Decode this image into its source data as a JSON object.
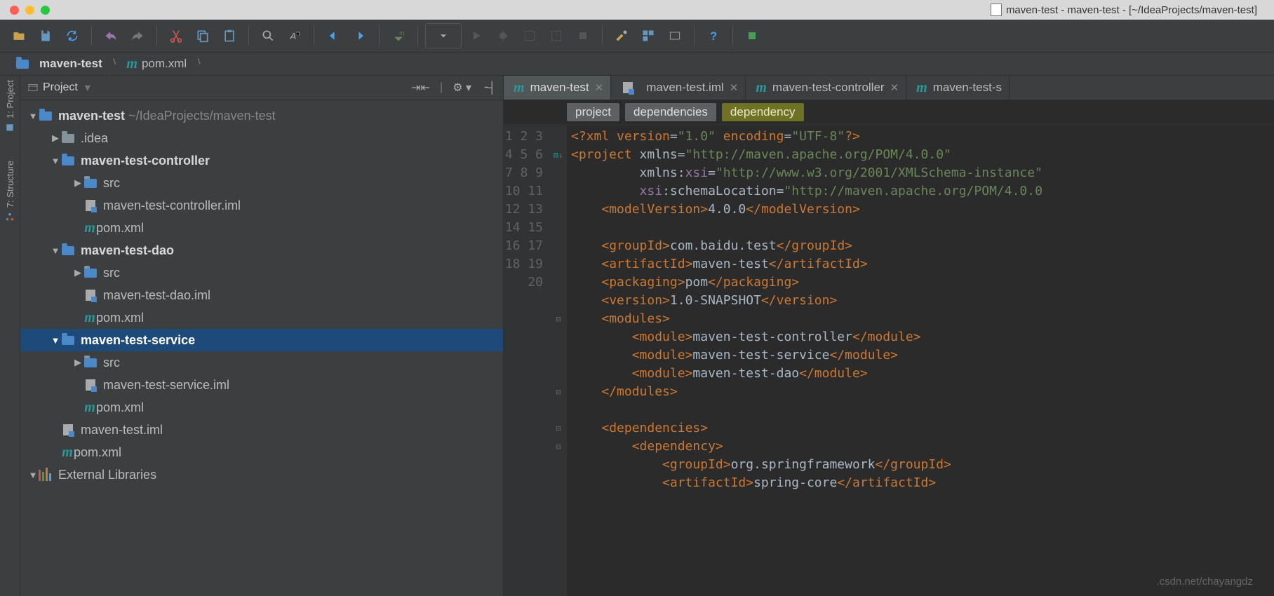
{
  "window_title": "maven-test - maven-test - [~/IdeaProjects/maven-test]",
  "breadcrumbs": [
    {
      "label": "maven-test"
    },
    {
      "label": "pom.xml"
    }
  ],
  "left_tabs": [
    {
      "label": "1: Project"
    },
    {
      "label": "7: Structure"
    }
  ],
  "project_panel": {
    "title": "Project"
  },
  "tree": {
    "root": {
      "name": "maven-test",
      "path": "~/IdeaProjects/maven-test"
    },
    "idea": ".idea",
    "mod_ctrl": "maven-test-controller",
    "src": "src",
    "ctrl_iml": "maven-test-controller.iml",
    "pom": "pom.xml",
    "mod_dao": "maven-test-dao",
    "dao_iml": "maven-test-dao.iml",
    "mod_svc": "maven-test-service",
    "svc_iml": "maven-test-service.iml",
    "root_iml": "maven-test.iml",
    "ext_lib": "External Libraries"
  },
  "editor_tabs": [
    {
      "label": "maven-test",
      "icon": "m",
      "closeable": true,
      "active": true
    },
    {
      "label": "maven-test.iml",
      "icon": "iml",
      "closeable": true
    },
    {
      "label": "maven-test-controller",
      "icon": "m",
      "closeable": true
    },
    {
      "label": "maven-test-s",
      "icon": "m",
      "closeable": false
    }
  ],
  "editor_crumbs": [
    {
      "label": "project"
    },
    {
      "label": "dependencies"
    },
    {
      "label": "dependency",
      "active": true
    }
  ],
  "line_start": 1,
  "line_end": 20,
  "code_lines": [
    {
      "html": "<span class='pi'>&lt;?</span><span class='t'>xml version</span><span class='tx'>=</span><span class='av'>\"1.0\"</span> <span class='t'>encoding</span><span class='tx'>=</span><span class='av'>\"UTF-8\"</span><span class='pi'>?&gt;</span>"
    },
    {
      "html": "<span class='t'>&lt;project </span><span class='tx'>xmlns</span><span class='tx'>=</span><span class='av'>\"http://maven.apache.org/POM/4.0.0\"</span>"
    },
    {
      "html": "         <span class='tx'>xmlns:</span><span class='an'>xsi</span><span class='tx'>=</span><span class='av'>\"http://www.w3.org/2001/XMLSchema-instance\"</span>"
    },
    {
      "html": "         <span class='an'>xsi</span><span class='tx'>:</span><span class='tx'>schemaLocation</span><span class='tx'>=</span><span class='av'>\"http://maven.apache.org/POM/4.0.0</span>"
    },
    {
      "html": "    <span class='t'>&lt;modelVersion&gt;</span><span class='tx'>4.0.0</span><span class='t'>&lt;/modelVersion&gt;</span>"
    },
    {
      "html": ""
    },
    {
      "html": "    <span class='t'>&lt;groupId&gt;</span><span class='tx'>com.baidu.test</span><span class='t'>&lt;/groupId&gt;</span>"
    },
    {
      "html": "    <span class='t'>&lt;artifactId&gt;</span><span class='tx'>maven-test</span><span class='t'>&lt;/artifactId&gt;</span>"
    },
    {
      "html": "    <span class='t'>&lt;packaging&gt;</span><span class='tx'>pom</span><span class='t'>&lt;/packaging&gt;</span>"
    },
    {
      "html": "    <span class='t'>&lt;version&gt;</span><span class='tx'>1.0-SNAPSHOT</span><span class='t'>&lt;/version&gt;</span>"
    },
    {
      "html": "    <span class='t'>&lt;modules&gt;</span>"
    },
    {
      "html": "        <span class='t'>&lt;module&gt;</span><span class='tx'>maven-test-controller</span><span class='t'>&lt;/module&gt;</span>"
    },
    {
      "html": "        <span class='t'>&lt;module&gt;</span><span class='tx'>maven-test-service</span><span class='t'>&lt;/module&gt;</span>"
    },
    {
      "html": "        <span class='t'>&lt;module&gt;</span><span class='tx'>maven-test-dao</span><span class='t'>&lt;/module&gt;</span>"
    },
    {
      "html": "    <span class='t'>&lt;/modules&gt;</span>"
    },
    {
      "html": ""
    },
    {
      "html": "    <span class='t'>&lt;dependencies&gt;</span>"
    },
    {
      "html": "        <span class='t'>&lt;dependency&gt;</span>"
    },
    {
      "html": "            <span class='t'>&lt;groupId&gt;</span><span class='tx'>org.springframework</span><span class='t'>&lt;/groupId&gt;</span>"
    },
    {
      "html": "            <span class='t'>&lt;artifactId&gt;</span><span class='tx'>spring-core</span><span class='t'>&lt;/artifactId&gt;</span>"
    }
  ],
  "fold_marks": {
    "2": "⊟",
    "11": "⊟",
    "15": "⊟",
    "17": "⊟",
    "18": "⊟"
  },
  "watermark": ".csdn.net/chayangdz"
}
